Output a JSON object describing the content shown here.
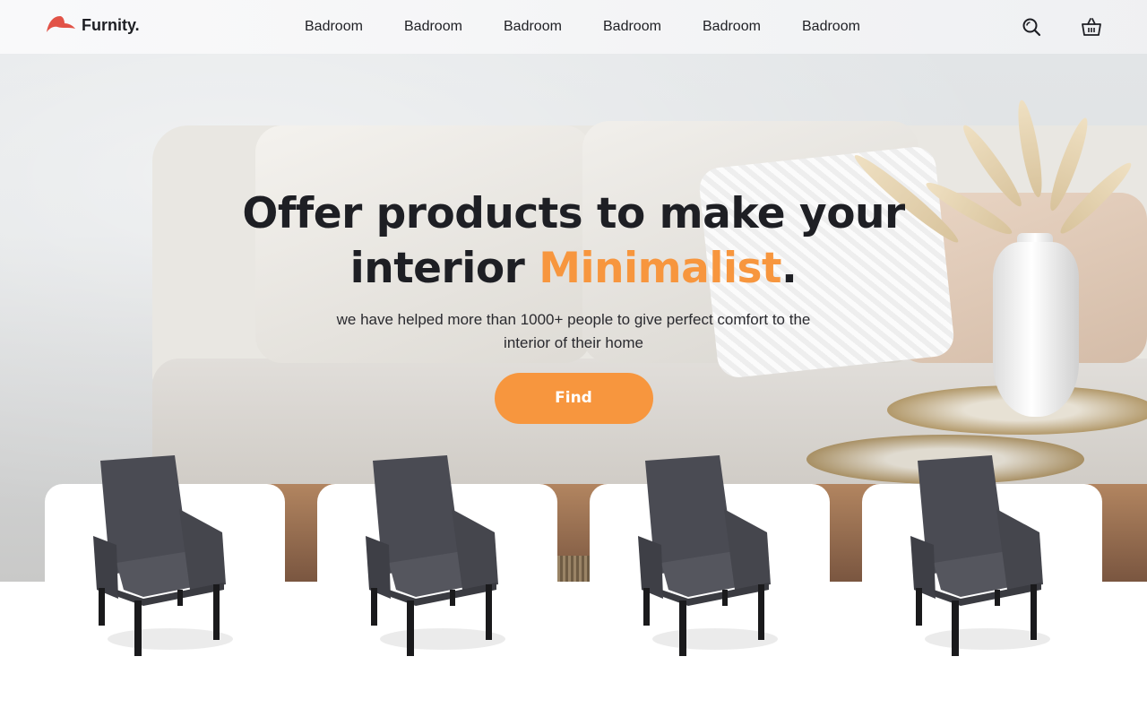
{
  "brand": {
    "name": "Furnity.",
    "logo_icon": "red-swoosh-logo",
    "logo_color": "#e25347"
  },
  "nav": {
    "items": [
      {
        "label": "Badroom"
      },
      {
        "label": "Badroom"
      },
      {
        "label": "Badroom"
      },
      {
        "label": "Badroom"
      },
      {
        "label": "Badroom"
      },
      {
        "label": "Badroom"
      }
    ],
    "icons": [
      "search-icon",
      "basket-icon"
    ]
  },
  "hero": {
    "title_line1": "Offer products to make your",
    "title_line2_prefix": "interior ",
    "title_accent": "Minimalist",
    "title_suffix": ".",
    "subtitle": "we have helped more than 1000+ people to give perfect comfort to the interior of their home",
    "cta_label": "Find",
    "accent_color": "#f7963e"
  },
  "products": [
    {
      "image": "gray-armchair"
    },
    {
      "image": "gray-armchair"
    },
    {
      "image": "gray-armchair"
    },
    {
      "image": "gray-armchair"
    }
  ]
}
